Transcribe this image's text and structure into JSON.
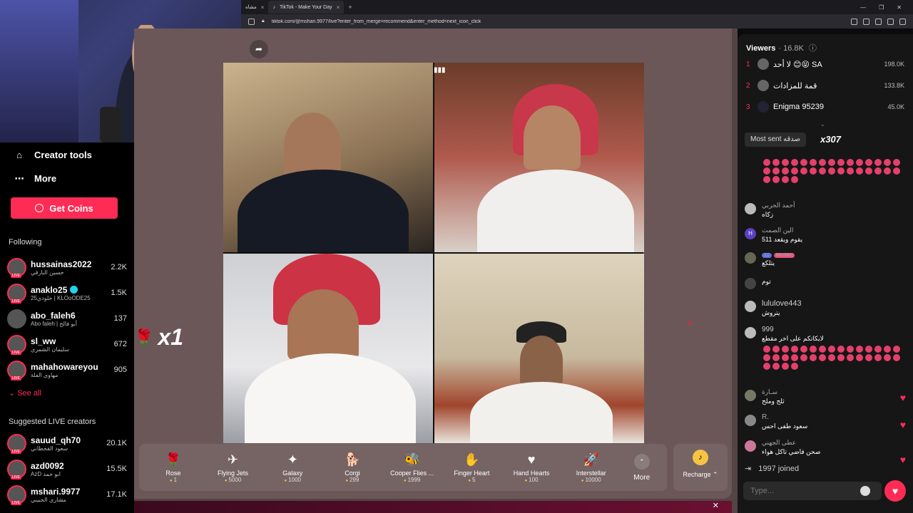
{
  "browser": {
    "tabs": [
      {
        "label": "مشاه",
        "active": false
      },
      {
        "label": "TikTok - Make Your Day",
        "active": true
      }
    ],
    "new_tab": "+",
    "url": "tiktok.com/@mshari.9977/live?enter_from_merge=recommend&enter_method=next_icon_click"
  },
  "sidebar": {
    "nav": [
      {
        "label": "Creator tools",
        "icon": "home-icon"
      },
      {
        "label": "More",
        "icon": "more-icon"
      }
    ],
    "get_coins": "Get Coins",
    "following_title": "Following",
    "following": [
      {
        "name": "hussainas2022",
        "sub": "حسين البارقي",
        "count": "2.2K"
      },
      {
        "name": "anaklo25",
        "sub": "خلودي25 | KLOoODE25",
        "count": "1.5K",
        "verified": true
      },
      {
        "name": "abo_faleh6",
        "sub": "Abo faleh | أبو فالح",
        "count": "137"
      },
      {
        "name": "sl_ww",
        "sub": "سليمان الشمري",
        "count": "672"
      },
      {
        "name": "mahahowareyou",
        "sub": "مهاوي الفلة",
        "count": "905"
      }
    ],
    "see_all": "See all",
    "suggested_title": "Suggested LIVE creators",
    "suggested": [
      {
        "name": "sauud_qh70",
        "sub": "سعود القحطاني",
        "count": "20.1K"
      },
      {
        "name": "azd0092",
        "sub": "AzD ابو حمد",
        "count": "15.5K"
      },
      {
        "name": "mshari.9977",
        "sub": "مشاري الحبيبي",
        "count": "17.1K"
      }
    ],
    "live_tag": "LIVE"
  },
  "stream": {
    "combo_multiplier": "x1",
    "gifts": [
      {
        "name": "Rose",
        "price": "1",
        "icon": "rose-icon",
        "glyph": "🌹"
      },
      {
        "name": "Flying Jets",
        "price": "5000",
        "icon": "jets-icon",
        "glyph": "✈"
      },
      {
        "name": "Galaxy",
        "price": "1000",
        "icon": "galaxy-icon",
        "glyph": "✦"
      },
      {
        "name": "Corgi",
        "price": "299",
        "icon": "corgi-icon",
        "glyph": "🐕"
      },
      {
        "name": "Cooper Flies ...",
        "price": "1999",
        "icon": "cooper-icon",
        "glyph": "🐝"
      },
      {
        "name": "Finger Heart",
        "price": "5",
        "icon": "finger-heart-icon",
        "glyph": "✋"
      },
      {
        "name": "Hand Hearts",
        "price": "100",
        "icon": "hand-hearts-icon",
        "glyph": "♥"
      },
      {
        "name": "Interstellar",
        "price": "10000",
        "icon": "interstellar-icon",
        "glyph": "🚀"
      }
    ],
    "more_label": "More",
    "recharge_label": "Recharge ⌃"
  },
  "chat": {
    "viewers_label": "Viewers",
    "viewers_count": "· 16.8K",
    "ranking": [
      {
        "rank": "1",
        "name": "لا أحد 😊😝 SA",
        "value": "198.0K"
      },
      {
        "rank": "2",
        "name": "قمة للمزادات",
        "value": "133.8K"
      },
      {
        "rank": "3",
        "name": "Enigma 95239",
        "value": "45.0K"
      }
    ],
    "most_sent_label": "Most sent صدقه",
    "most_sent_mult": "x307",
    "messages": [
      {
        "name": "أحمد الحربي",
        "text": "زكاه",
        "avatar": ""
      },
      {
        "name": "الين الصمت",
        "text": "يقوم ويقعد 511",
        "avatar": "H"
      },
      {
        "name": "",
        "text": "يتلكع",
        "avatar": "",
        "badges": [
          "21",
          "MmMm"
        ]
      },
      {
        "name": "",
        "text": "توم",
        "avatar": ""
      },
      {
        "name": "lululove443",
        "text": "يتروش",
        "avatar": ""
      },
      {
        "name": "999",
        "text": "لايكاتكم على اخر مقطع",
        "avatar": ""
      },
      {
        "name": "سـارة",
        "text": "ثلج وملح",
        "avatar": ""
      },
      {
        "name": "R.",
        "text": "سعود طفى احس",
        "avatar": ""
      },
      {
        "name": "عطى الجهني",
        "text": "صحن فاضي تاكل هواء",
        "avatar": ""
      }
    ],
    "joined_text": "1997  joined",
    "input_placeholder": "Type..."
  }
}
